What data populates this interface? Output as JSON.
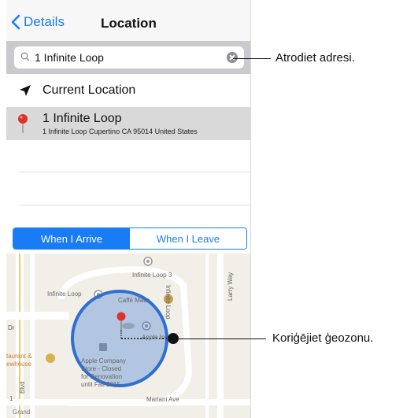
{
  "nav": {
    "back_label": "Details",
    "title": "Location"
  },
  "search": {
    "value": "1 Infinite Loop"
  },
  "current_location": {
    "label": "Current Location"
  },
  "result": {
    "title": "1 Infinite Loop",
    "subtitle": "1 Infinite Loop Cupertino CA 95014 United States"
  },
  "segments": {
    "arrive": "When I Arrive",
    "leave": "When I Leave",
    "selected": "arrive"
  },
  "map": {
    "poi_infinite_loop_3": "Infinite Loop 3",
    "poi_infinite_loop": "Infinite Loop",
    "poi_caffe_macs": "Caffè Macs",
    "poi_apple_inc": "Apple Inc.",
    "poi_apple_company_store": [
      "Apple Company",
      "Store - Closed",
      "for Renovation",
      "until Fall 2015"
    ],
    "poi_restaurant": [
      "taurant &",
      "ewhouse"
    ],
    "street_infinite_loop": "Infinite Loop",
    "street_larry_way": "Larry Way",
    "street_mariani_ave": "Mariani Ave",
    "street_dr": "Dr",
    "street_blvd": "Blvd",
    "street_1": "1",
    "poi_grand": "Grand"
  },
  "callouts": {
    "address": "Atrodiet adresi.",
    "geofence": "Koriģējiet ģeozonu."
  },
  "colors": {
    "accent": "#1a7cf4",
    "geofence": "#2f6fd0",
    "pin": "#e0302b"
  }
}
